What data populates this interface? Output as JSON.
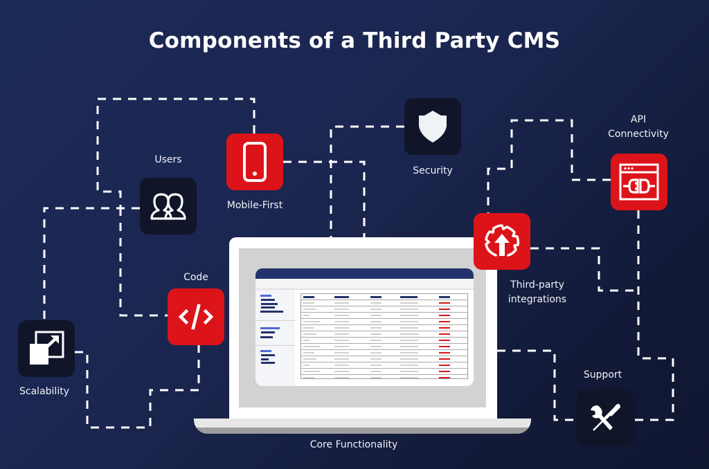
{
  "title": "Components of a Third Party CMS",
  "colors": {
    "background_start": "#1c2a58",
    "background_end": "#0f1630",
    "accent_red": "#dc1419",
    "dark_tile": "#10152a",
    "connector": "#ffffff"
  },
  "center": {
    "label": "Core Functionality",
    "icon": "laptop-dashboard-icon"
  },
  "components": [
    {
      "id": "users",
      "label": "Users",
      "icon": "users-icon",
      "style": "dark"
    },
    {
      "id": "mobile-first",
      "label": "Mobile-First",
      "icon": "smartphone-icon",
      "style": "red"
    },
    {
      "id": "security",
      "label": "Security",
      "icon": "shield-icon",
      "style": "dark"
    },
    {
      "id": "api-connectivity",
      "label_line1": "API",
      "label_line2": "Connectivity",
      "icon": "api-plug-icon",
      "style": "red"
    },
    {
      "id": "third-party-integrations",
      "label_line1": "Third-party",
      "label_line2": "integrations",
      "icon": "gear-upload-icon",
      "style": "red"
    },
    {
      "id": "code",
      "label": "Code",
      "icon": "code-icon",
      "style": "red"
    },
    {
      "id": "scalability",
      "label": "Scalability",
      "icon": "resize-icon",
      "style": "dark"
    },
    {
      "id": "support",
      "label": "Support",
      "icon": "tools-icon",
      "style": "dark"
    }
  ]
}
